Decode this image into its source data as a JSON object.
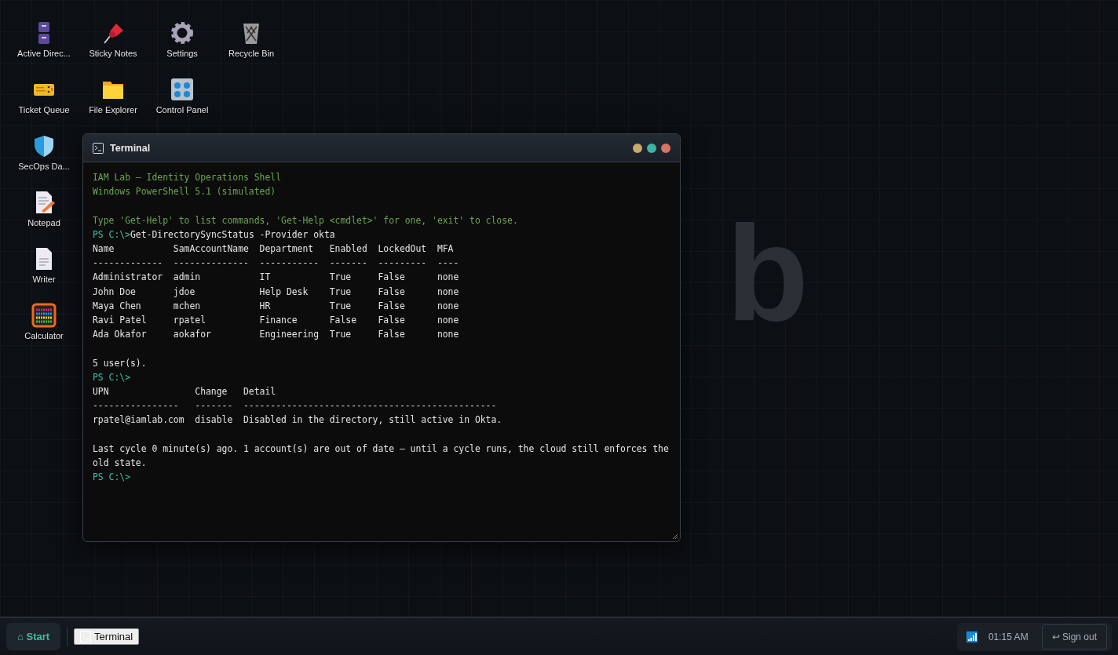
{
  "desktop": {
    "wallpaper_text": "b",
    "icons": [
      {
        "label": "Active Direc..."
      },
      {
        "label": "Sticky Notes"
      },
      {
        "label": "Settings"
      },
      {
        "label": "Recycle Bin"
      },
      {
        "label": "Ticket Queue"
      },
      {
        "label": "File Explorer"
      },
      {
        "label": "Control Panel"
      },
      {
        "label": "SecOps Da..."
      },
      {
        "label": "Notepad"
      },
      {
        "label": "Writer"
      },
      {
        "label": "Calculator"
      }
    ]
  },
  "terminal": {
    "title": "Terminal",
    "lines": [
      {
        "kind": "banner",
        "text": "IAM Lab — Identity Operations Shell"
      },
      {
        "kind": "banner",
        "text": "Windows PowerShell 5.1 (simulated)"
      },
      {
        "kind": "blank"
      },
      {
        "kind": "banner",
        "text": "Type 'Get-Help' to list commands, 'Get-Help <cmdlet>' for one, 'exit' to close."
      },
      {
        "kind": "prompt",
        "prompt": "PS C:\\>",
        "command": "Get-DirectorySyncStatus -Provider okta"
      },
      {
        "kind": "output",
        "text": "Name           SamAccountName  Department   Enabled  LockedOut  MFA"
      },
      {
        "kind": "output",
        "text": "-------------  --------------  -----------  -------  ---------  ----"
      },
      {
        "kind": "output",
        "text": "Administrator  admin           IT           True     False      none"
      },
      {
        "kind": "output",
        "text": "John Doe       jdoe            Help Desk    True     False      none"
      },
      {
        "kind": "output",
        "text": "Maya Chen      mchen           HR           True     False      none"
      },
      {
        "kind": "output",
        "text": "Ravi Patel     rpatel          Finance      False    False      none"
      },
      {
        "kind": "output",
        "text": "Ada Okafor     aokafor         Engineering  True     False      none"
      },
      {
        "kind": "blank"
      },
      {
        "kind": "output",
        "text": "5 user(s)."
      },
      {
        "kind": "prompt",
        "prompt": "PS C:\\>"
      },
      {
        "kind": "output",
        "text": "UPN                Change   Detail"
      },
      {
        "kind": "output",
        "text": "----------------   -------  -----------------------------------------------"
      },
      {
        "kind": "output",
        "text": "rpatel@iamlab.com  disable  Disabled in the directory, still active in Okta."
      },
      {
        "kind": "blank"
      },
      {
        "kind": "output",
        "text": "Last cycle 0 minute(s) ago. 1 account(s) are out of date — until a cycle runs, the cloud still enforces the old state."
      },
      {
        "kind": "prompt",
        "prompt": "PS C:\\>"
      }
    ]
  },
  "taskbar": {
    "start": {
      "icon": "⌂",
      "label": "Start"
    },
    "apps": [
      {
        "label": "Terminal",
        "selected": true
      }
    ],
    "clock": "01:15 AM",
    "sign_out": {
      "icon": "↩",
      "label": "Sign out"
    }
  }
}
